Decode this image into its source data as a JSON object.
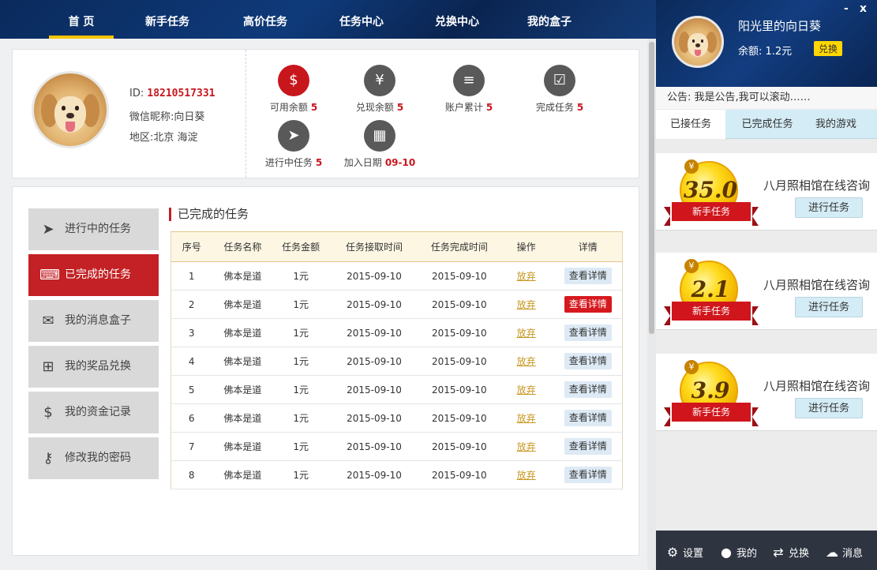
{
  "nav": {
    "items": [
      "首 页",
      "新手任务",
      "高价任务",
      "任务中心",
      "兑换中心",
      "我的盒子"
    ]
  },
  "profile": {
    "id_label": "ID:",
    "id_value": "18210517331",
    "wechat_label": "微信昵称:",
    "wechat_value": "向日葵",
    "region_label": "地区:",
    "region_value": "北京 海淀",
    "stats": [
      {
        "icon": "dollar-icon",
        "label": "可用余额",
        "value": "5"
      },
      {
        "icon": "withdraw-icon",
        "label": "兑现余额",
        "value": "5"
      },
      {
        "icon": "coins-stack-icon",
        "label": "账户累计",
        "value": "5"
      },
      {
        "icon": "check-box-icon",
        "label": "完成任务",
        "value": "5"
      },
      {
        "icon": "paper-plane-icon",
        "label": "进行中任务",
        "value": "5"
      },
      {
        "icon": "calendar-icon",
        "label": "加入日期",
        "value": "09-10"
      }
    ]
  },
  "sidebar": {
    "items": [
      {
        "icon": "paper-plane-icon",
        "label": "进行中的任务",
        "active": false
      },
      {
        "icon": "gamepad-icon",
        "label": "已完成的任务",
        "active": true
      },
      {
        "icon": "inbox-icon",
        "label": "我的消息盒子",
        "active": false
      },
      {
        "icon": "gift-icon",
        "label": "我的奖品兑换",
        "active": false
      },
      {
        "icon": "money-icon",
        "label": "我的资金记录",
        "active": false
      },
      {
        "icon": "key-icon",
        "label": "修改我的密码",
        "active": false
      }
    ]
  },
  "tasks": {
    "title": "已完成的任务",
    "columns": [
      "序号",
      "任务名称",
      "任务金额",
      "任务接取时间",
      "任务完成时间",
      "操作",
      "详情"
    ],
    "rows": [
      {
        "no": "1",
        "name": "佛本是道",
        "amount": "1元",
        "accept": "2015-09-10",
        "finish": "2015-09-10",
        "op": "放弃",
        "detail": "查看详情",
        "hot": false
      },
      {
        "no": "2",
        "name": "佛本是道",
        "amount": "1元",
        "accept": "2015-09-10",
        "finish": "2015-09-10",
        "op": "放弃",
        "detail": "查看详情",
        "hot": true
      },
      {
        "no": "3",
        "name": "佛本是道",
        "amount": "1元",
        "accept": "2015-09-10",
        "finish": "2015-09-10",
        "op": "放弃",
        "detail": "查看详情",
        "hot": false
      },
      {
        "no": "4",
        "name": "佛本是道",
        "amount": "1元",
        "accept": "2015-09-10",
        "finish": "2015-09-10",
        "op": "放弃",
        "detail": "查看详情",
        "hot": false
      },
      {
        "no": "5",
        "name": "佛本是道",
        "amount": "1元",
        "accept": "2015-09-10",
        "finish": "2015-09-10",
        "op": "放弃",
        "detail": "查看详情",
        "hot": false
      },
      {
        "no": "6",
        "name": "佛本是道",
        "amount": "1元",
        "accept": "2015-09-10",
        "finish": "2015-09-10",
        "op": "放弃",
        "detail": "查看详情",
        "hot": false
      },
      {
        "no": "7",
        "name": "佛本是道",
        "amount": "1元",
        "accept": "2015-09-10",
        "finish": "2015-09-10",
        "op": "放弃",
        "detail": "查看详情",
        "hot": false
      },
      {
        "no": "8",
        "name": "佛本是道",
        "amount": "1元",
        "accept": "2015-09-10",
        "finish": "2015-09-10",
        "op": "放弃",
        "detail": "查看详情",
        "hot": false
      }
    ]
  },
  "right": {
    "username": "阳光里的向日葵",
    "balance": "余额: 1.2元",
    "exchange_label": "兑换",
    "minimize": "-",
    "close": "x",
    "notice": "公告: 我是公告,我可以滚动……",
    "tabs": [
      "已接任务",
      "已完成任务",
      "我的游戏"
    ],
    "cards": [
      {
        "amount": "35.0",
        "yen": "¥",
        "ribbon": "新手任务",
        "title": "八月照相馆在线咨询",
        "button": "进行任务"
      },
      {
        "amount": "2.1",
        "yen": "¥",
        "ribbon": "新手任务",
        "title": "八月照相馆在线咨询",
        "button": "进行任务"
      },
      {
        "amount": "3.9",
        "yen": "¥",
        "ribbon": "新手任务",
        "title": "八月照相馆在线咨询",
        "button": "进行任务"
      }
    ],
    "footer": [
      {
        "icon": "gear-icon",
        "label": "设置"
      },
      {
        "icon": "user-icon",
        "label": "我的"
      },
      {
        "icon": "exchange-icon",
        "label": "兑换"
      },
      {
        "icon": "chat-icon",
        "label": "消息"
      }
    ]
  }
}
